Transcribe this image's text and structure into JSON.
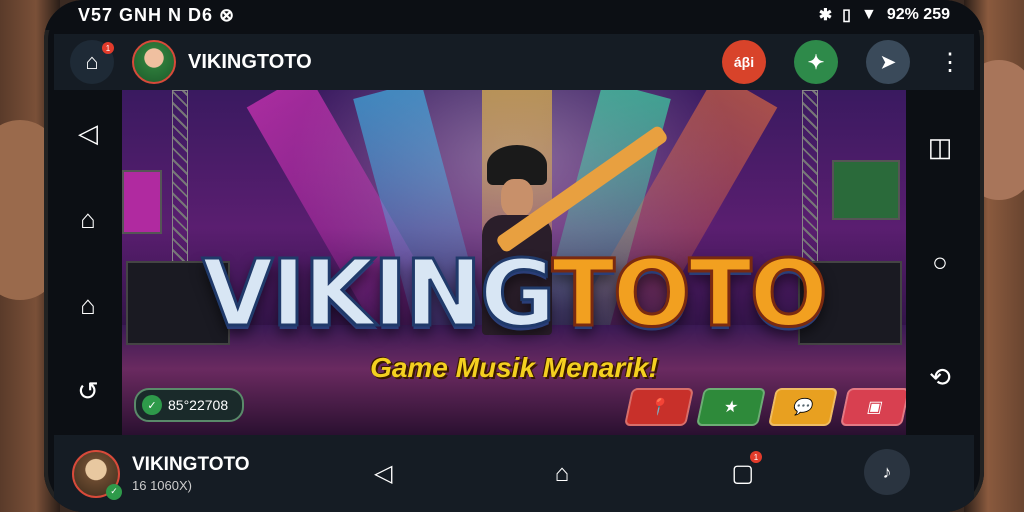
{
  "status_bar": {
    "left_text": "V57 GNH N D6 ⊗",
    "right_text": "92% 259"
  },
  "app_bar": {
    "title": "VIKINGTOTO",
    "home_icon": "home-icon",
    "home_badge": "1",
    "actions": [
      {
        "name": "gift-icon",
        "label": "áβi"
      },
      {
        "name": "badge-icon",
        "label": "✦"
      },
      {
        "name": "pointer-icon",
        "label": "➤"
      }
    ],
    "menu_icon": "kebab-menu-icon"
  },
  "side_left": [
    "back-icon",
    "home-icon",
    "home-icon",
    "refresh-icon"
  ],
  "side_right": [
    "split-view-icon",
    "circle-icon",
    "rotate-icon"
  ],
  "banner": {
    "logo_part1": "VIKING",
    "logo_part2": "TOTO",
    "tagline": "Game Musik Menarik!",
    "counter": "85°22708"
  },
  "banner_buttons": [
    {
      "name": "location-icon",
      "label": "📍"
    },
    {
      "name": "star-icon",
      "label": "★"
    },
    {
      "name": "chat-icon",
      "label": "💬"
    },
    {
      "name": "gallery-icon",
      "label": "▣"
    }
  ],
  "bottom_bar": {
    "username": "VIKINGTOTO",
    "subtitle": "16 1060X)",
    "recent_badge": "1",
    "float_icon": "audio-icon"
  }
}
